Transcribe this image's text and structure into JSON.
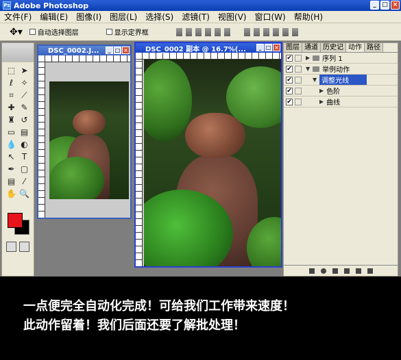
{
  "window": {
    "title": "Adobe Photoshop",
    "logo_text": "Ps"
  },
  "menu": [
    "文件(F)",
    "编辑(E)",
    "图像(I)",
    "图层(L)",
    "选择(S)",
    "滤镜(T)",
    "视图(V)",
    "窗口(W)",
    "帮助(H)"
  ],
  "options": {
    "auto_select_layer": "自动选择图层",
    "show_bounding_box": "显示定界框"
  },
  "docs": {
    "small": {
      "title": "DSC_0002.J..."
    },
    "large": {
      "title": "DSC_0002 副本 @ 16.7%(..."
    }
  },
  "panel": {
    "tabs": [
      "图层",
      "通道",
      "历史记",
      "动作",
      "路径"
    ],
    "actions": [
      {
        "label": "序列 1",
        "checked": true
      },
      {
        "label": "举例动作",
        "checked": true
      },
      {
        "label": "调整光线",
        "checked": true,
        "selected": true
      },
      {
        "label": "色阶",
        "checked": true
      },
      {
        "label": "曲线",
        "checked": true
      }
    ]
  },
  "colors": {
    "foreground": "#e8141c",
    "background": "#000000",
    "accent": "#2a56c6"
  },
  "caption": {
    "line1": "一点便完全自动化完成！可给我们工作带来速度！",
    "line2": "此动作留着！我们后面还要了解批处理！"
  }
}
